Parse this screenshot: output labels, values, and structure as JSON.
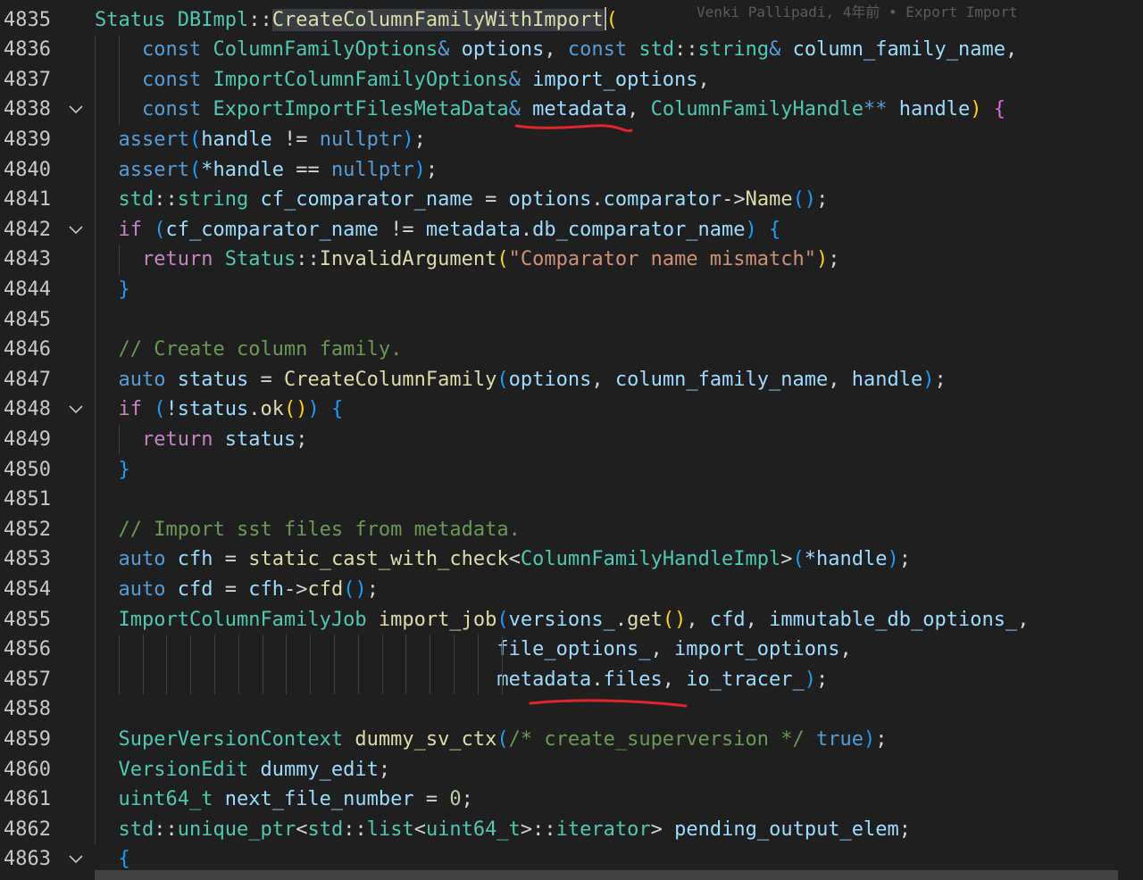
{
  "editor": {
    "blame_annotation": "Venki Pallipadi, 4年前 • Export Import",
    "accent_colors": {
      "underline": "#e0262b",
      "selection": "#3a3d41"
    },
    "lines": [
      {
        "num": "4835",
        "fold": false,
        "tokens": [
          [
            "Status",
            "t-type"
          ],
          [
            " ",
            ""
          ],
          [
            "DBImpl",
            "t-type"
          ],
          [
            "::",
            "t-op"
          ],
          [
            "CreateColumnFamilyWithImport",
            "t-fn hl-sel"
          ],
          [
            "(",
            "t-b1"
          ]
        ]
      },
      {
        "num": "4836",
        "fold": false,
        "tokens": [
          [
            "    ",
            ""
          ],
          [
            "const",
            "t-kw"
          ],
          [
            " ",
            ""
          ],
          [
            "ColumnFamilyOptions",
            "t-type"
          ],
          [
            "&",
            "t-kw"
          ],
          [
            " ",
            ""
          ],
          [
            "options",
            "t-var"
          ],
          [
            ", ",
            "t-op"
          ],
          [
            "const",
            "t-kw"
          ],
          [
            " ",
            ""
          ],
          [
            "std",
            "t-type"
          ],
          [
            "::",
            "t-op"
          ],
          [
            "string",
            "t-type"
          ],
          [
            "&",
            "t-kw"
          ],
          [
            " ",
            ""
          ],
          [
            "column_family_name",
            "t-var"
          ],
          [
            ",",
            "t-op"
          ]
        ]
      },
      {
        "num": "4837",
        "fold": false,
        "tokens": [
          [
            "    ",
            ""
          ],
          [
            "const",
            "t-kw"
          ],
          [
            " ",
            ""
          ],
          [
            "ImportColumnFamilyOptions",
            "t-type"
          ],
          [
            "&",
            "t-kw"
          ],
          [
            " ",
            ""
          ],
          [
            "import_options",
            "t-var"
          ],
          [
            ",",
            "t-op"
          ]
        ]
      },
      {
        "num": "4838",
        "fold": true,
        "tokens": [
          [
            "    ",
            ""
          ],
          [
            "const",
            "t-kw"
          ],
          [
            " ",
            ""
          ],
          [
            "ExportImportFilesMetaData",
            "t-type"
          ],
          [
            "&",
            "t-kw"
          ],
          [
            " ",
            ""
          ],
          [
            "metadata",
            "t-var"
          ],
          [
            ", ",
            "t-op"
          ],
          [
            "ColumnFamilyHandle",
            "t-type"
          ],
          [
            "**",
            "t-kw"
          ],
          [
            " ",
            ""
          ],
          [
            "handle",
            "t-var"
          ],
          [
            ")",
            "t-b1"
          ],
          [
            " ",
            ""
          ],
          [
            "{",
            "t-b2"
          ]
        ]
      },
      {
        "num": "4839",
        "fold": false,
        "tokens": [
          [
            "  ",
            ""
          ],
          [
            "assert",
            "t-kw"
          ],
          [
            "(",
            "t-b3"
          ],
          [
            "handle",
            "t-var"
          ],
          [
            " != ",
            "t-op"
          ],
          [
            "nullptr",
            "t-kw"
          ],
          [
            ")",
            "t-b3"
          ],
          [
            ";",
            "t-op"
          ]
        ]
      },
      {
        "num": "4840",
        "fold": false,
        "tokens": [
          [
            "  ",
            ""
          ],
          [
            "assert",
            "t-kw"
          ],
          [
            "(",
            "t-b3"
          ],
          [
            "*handle",
            "t-var"
          ],
          [
            " == ",
            "t-op"
          ],
          [
            "nullptr",
            "t-kw"
          ],
          [
            ")",
            "t-b3"
          ],
          [
            ";",
            "t-op"
          ]
        ]
      },
      {
        "num": "4841",
        "fold": false,
        "tokens": [
          [
            "  ",
            ""
          ],
          [
            "std",
            "t-type"
          ],
          [
            "::",
            "t-op"
          ],
          [
            "string",
            "t-type"
          ],
          [
            " ",
            ""
          ],
          [
            "cf_comparator_name",
            "t-var"
          ],
          [
            " = ",
            "t-op"
          ],
          [
            "options",
            "t-var"
          ],
          [
            ".",
            "t-op"
          ],
          [
            "comparator",
            "t-var"
          ],
          [
            "->",
            "t-op"
          ],
          [
            "Name",
            "t-fn"
          ],
          [
            "()",
            "t-b3"
          ],
          [
            ";",
            "t-op"
          ]
        ]
      },
      {
        "num": "4842",
        "fold": true,
        "tokens": [
          [
            "  ",
            ""
          ],
          [
            "if",
            "t-ctrl"
          ],
          [
            " ",
            ""
          ],
          [
            "(",
            "t-b3"
          ],
          [
            "cf_comparator_name",
            "t-var"
          ],
          [
            " != ",
            "t-op"
          ],
          [
            "metadata",
            "t-var"
          ],
          [
            ".",
            "t-op"
          ],
          [
            "db_comparator_name",
            "t-var"
          ],
          [
            ")",
            "t-b3"
          ],
          [
            " ",
            ""
          ],
          [
            "{",
            "t-b3"
          ]
        ]
      },
      {
        "num": "4843",
        "fold": false,
        "tokens": [
          [
            "    ",
            ""
          ],
          [
            "return",
            "t-ctrl"
          ],
          [
            " ",
            ""
          ],
          [
            "Status",
            "t-type"
          ],
          [
            "::",
            "t-op"
          ],
          [
            "InvalidArgument",
            "t-fn"
          ],
          [
            "(",
            "t-b1"
          ],
          [
            "\"Comparator name mismatch\"",
            "t-str"
          ],
          [
            ")",
            "t-b1"
          ],
          [
            ";",
            "t-op"
          ]
        ]
      },
      {
        "num": "4844",
        "fold": false,
        "tokens": [
          [
            "  ",
            ""
          ],
          [
            "}",
            "t-b3"
          ]
        ]
      },
      {
        "num": "4845",
        "fold": false,
        "tokens": []
      },
      {
        "num": "4846",
        "fold": false,
        "tokens": [
          [
            "  ",
            ""
          ],
          [
            "// Create column family.",
            "t-com"
          ]
        ]
      },
      {
        "num": "4847",
        "fold": false,
        "tokens": [
          [
            "  ",
            ""
          ],
          [
            "auto",
            "t-kw"
          ],
          [
            " ",
            ""
          ],
          [
            "status",
            "t-var"
          ],
          [
            " = ",
            "t-op"
          ],
          [
            "CreateColumnFamily",
            "t-fn"
          ],
          [
            "(",
            "t-b3"
          ],
          [
            "options",
            "t-var"
          ],
          [
            ", ",
            "t-op"
          ],
          [
            "column_family_name",
            "t-var"
          ],
          [
            ", ",
            "t-op"
          ],
          [
            "handle",
            "t-var"
          ],
          [
            ")",
            "t-b3"
          ],
          [
            ";",
            "t-op"
          ]
        ]
      },
      {
        "num": "4848",
        "fold": true,
        "tokens": [
          [
            "  ",
            ""
          ],
          [
            "if",
            "t-ctrl"
          ],
          [
            " ",
            ""
          ],
          [
            "(",
            "t-b3"
          ],
          [
            "!status",
            "t-var"
          ],
          [
            ".",
            "t-op"
          ],
          [
            "ok",
            "t-fn"
          ],
          [
            "()",
            "t-b1"
          ],
          [
            ")",
            "t-b3"
          ],
          [
            " ",
            ""
          ],
          [
            "{",
            "t-b3"
          ]
        ]
      },
      {
        "num": "4849",
        "fold": false,
        "tokens": [
          [
            "    ",
            ""
          ],
          [
            "return",
            "t-ctrl"
          ],
          [
            " ",
            ""
          ],
          [
            "status",
            "t-var"
          ],
          [
            ";",
            "t-op"
          ]
        ]
      },
      {
        "num": "4850",
        "fold": false,
        "tokens": [
          [
            "  ",
            ""
          ],
          [
            "}",
            "t-b3"
          ]
        ]
      },
      {
        "num": "4851",
        "fold": false,
        "tokens": []
      },
      {
        "num": "4852",
        "fold": false,
        "tokens": [
          [
            "  ",
            ""
          ],
          [
            "// Import sst files from metadata.",
            "t-com"
          ]
        ]
      },
      {
        "num": "4853",
        "fold": false,
        "tokens": [
          [
            "  ",
            ""
          ],
          [
            "auto",
            "t-kw"
          ],
          [
            " ",
            ""
          ],
          [
            "cfh",
            "t-var"
          ],
          [
            " = ",
            "t-op"
          ],
          [
            "static_cast_with_check",
            "t-fn"
          ],
          [
            "<",
            "t-op"
          ],
          [
            "ColumnFamilyHandleImpl",
            "t-type"
          ],
          [
            ">",
            "t-op"
          ],
          [
            "(",
            "t-b3"
          ],
          [
            "*handle",
            "t-var"
          ],
          [
            ")",
            "t-b3"
          ],
          [
            ";",
            "t-op"
          ]
        ]
      },
      {
        "num": "4854",
        "fold": false,
        "tokens": [
          [
            "  ",
            ""
          ],
          [
            "auto",
            "t-kw"
          ],
          [
            " ",
            ""
          ],
          [
            "cfd",
            "t-var"
          ],
          [
            " = ",
            "t-op"
          ],
          [
            "cfh",
            "t-var"
          ],
          [
            "->",
            "t-op"
          ],
          [
            "cfd",
            "t-fn"
          ],
          [
            "()",
            "t-b3"
          ],
          [
            ";",
            "t-op"
          ]
        ]
      },
      {
        "num": "4855",
        "fold": false,
        "tokens": [
          [
            "  ",
            ""
          ],
          [
            "ImportColumnFamilyJob",
            "t-type"
          ],
          [
            " ",
            ""
          ],
          [
            "import_job",
            "t-fn"
          ],
          [
            "(",
            "t-b3"
          ],
          [
            "versions_",
            "t-var"
          ],
          [
            ".",
            "t-op"
          ],
          [
            "get",
            "t-fn"
          ],
          [
            "()",
            "t-b1"
          ],
          [
            ", ",
            "t-op"
          ],
          [
            "cfd",
            "t-var"
          ],
          [
            ", ",
            "t-op"
          ],
          [
            "immutable_db_options_",
            "t-var"
          ],
          [
            ",",
            "t-op"
          ]
        ]
      },
      {
        "num": "4856",
        "fold": false,
        "tokens": [
          [
            "                                  ",
            ""
          ],
          [
            "file_options_",
            "t-var"
          ],
          [
            ", ",
            "t-op"
          ],
          [
            "import_options",
            "t-var"
          ],
          [
            ",",
            "t-op"
          ]
        ]
      },
      {
        "num": "4857",
        "fold": false,
        "tokens": [
          [
            "                                  ",
            ""
          ],
          [
            "metadata",
            "t-var"
          ],
          [
            ".",
            "t-op"
          ],
          [
            "files",
            "t-var"
          ],
          [
            ", ",
            "t-op"
          ],
          [
            "io_tracer_",
            "t-var"
          ],
          [
            ")",
            "t-b3"
          ],
          [
            ";",
            "t-op"
          ]
        ]
      },
      {
        "num": "4858",
        "fold": false,
        "tokens": []
      },
      {
        "num": "4859",
        "fold": false,
        "tokens": [
          [
            "  ",
            ""
          ],
          [
            "SuperVersionContext",
            "t-type"
          ],
          [
            " ",
            ""
          ],
          [
            "dummy_sv_ctx",
            "t-fn"
          ],
          [
            "(",
            "t-b3"
          ],
          [
            "/* create_superversion */",
            "t-com"
          ],
          [
            " ",
            ""
          ],
          [
            "true",
            "t-kw"
          ],
          [
            ")",
            "t-b3"
          ],
          [
            ";",
            "t-op"
          ]
        ]
      },
      {
        "num": "4860",
        "fold": false,
        "tokens": [
          [
            "  ",
            ""
          ],
          [
            "VersionEdit",
            "t-type"
          ],
          [
            " ",
            ""
          ],
          [
            "dummy_edit",
            "t-var"
          ],
          [
            ";",
            "t-op"
          ]
        ]
      },
      {
        "num": "4861",
        "fold": false,
        "tokens": [
          [
            "  ",
            ""
          ],
          [
            "uint64_t",
            "t-type"
          ],
          [
            " ",
            ""
          ],
          [
            "next_file_number",
            "t-var"
          ],
          [
            " = ",
            "t-op"
          ],
          [
            "0",
            "t-num"
          ],
          [
            ";",
            "t-op"
          ]
        ]
      },
      {
        "num": "4862",
        "fold": false,
        "tokens": [
          [
            "  ",
            ""
          ],
          [
            "std",
            "t-type"
          ],
          [
            "::",
            "t-op"
          ],
          [
            "unique_ptr",
            "t-type"
          ],
          [
            "<",
            "t-op"
          ],
          [
            "std",
            "t-type"
          ],
          [
            "::",
            "t-op"
          ],
          [
            "list",
            "t-type"
          ],
          [
            "<",
            "t-op"
          ],
          [
            "uint64_t",
            "t-type"
          ],
          [
            ">::",
            "t-op"
          ],
          [
            "iterator",
            "t-type"
          ],
          [
            "> ",
            "t-op"
          ],
          [
            "pending_output_elem",
            "t-var"
          ],
          [
            ";",
            "t-op"
          ]
        ]
      },
      {
        "num": "4863",
        "fold": true,
        "tokens": [
          [
            "  ",
            ""
          ],
          [
            "{",
            "t-b3"
          ]
        ]
      }
    ]
  }
}
